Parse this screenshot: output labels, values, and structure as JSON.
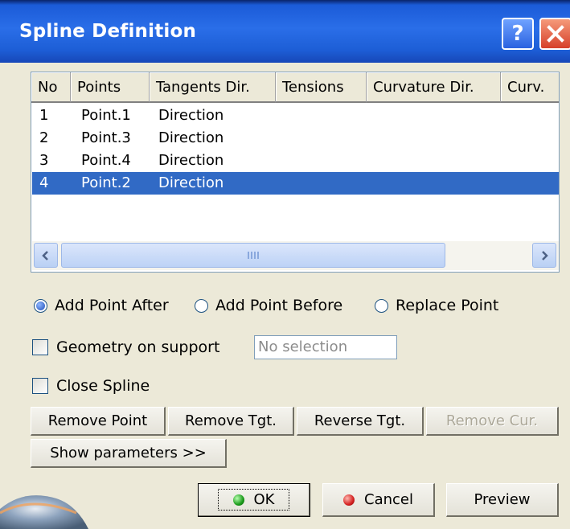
{
  "window": {
    "title": "Spline Definition",
    "help_label": "?"
  },
  "table": {
    "columns": [
      "No",
      "Points",
      "Tangents Dir.",
      "Tensions",
      "Curvature Dir.",
      "Curv."
    ],
    "rows": [
      {
        "no": "1",
        "point": "Point.1",
        "tangent": "Direction"
      },
      {
        "no": "2",
        "point": "Point.3",
        "tangent": "Direction"
      },
      {
        "no": "3",
        "point": "Point.4",
        "tangent": "Direction"
      },
      {
        "no": "4",
        "point": "Point.2",
        "tangent": "Direction"
      }
    ],
    "selected_row": 4
  },
  "radios": {
    "add_after": "Add Point After",
    "add_before": "Add Point Before",
    "replace": "Replace Point",
    "selected": "add_after"
  },
  "geometry_on_support": {
    "label": "Geometry on support",
    "value": "No selection",
    "checked": false
  },
  "close_spline": {
    "label": "Close Spline",
    "checked": false
  },
  "actions": {
    "remove_point": "Remove Point",
    "remove_tgt": "Remove Tgt.",
    "reverse_tgt": "Reverse Tgt.",
    "remove_cur": "Remove Cur.",
    "show_parameters": "Show parameters >>"
  },
  "footer": {
    "ok": "OK",
    "cancel": "Cancel",
    "preview": "Preview"
  },
  "colors": {
    "titlebar": "#2a6ee8",
    "selection": "#316ac5",
    "dialog_bg": "#ece9d8"
  }
}
